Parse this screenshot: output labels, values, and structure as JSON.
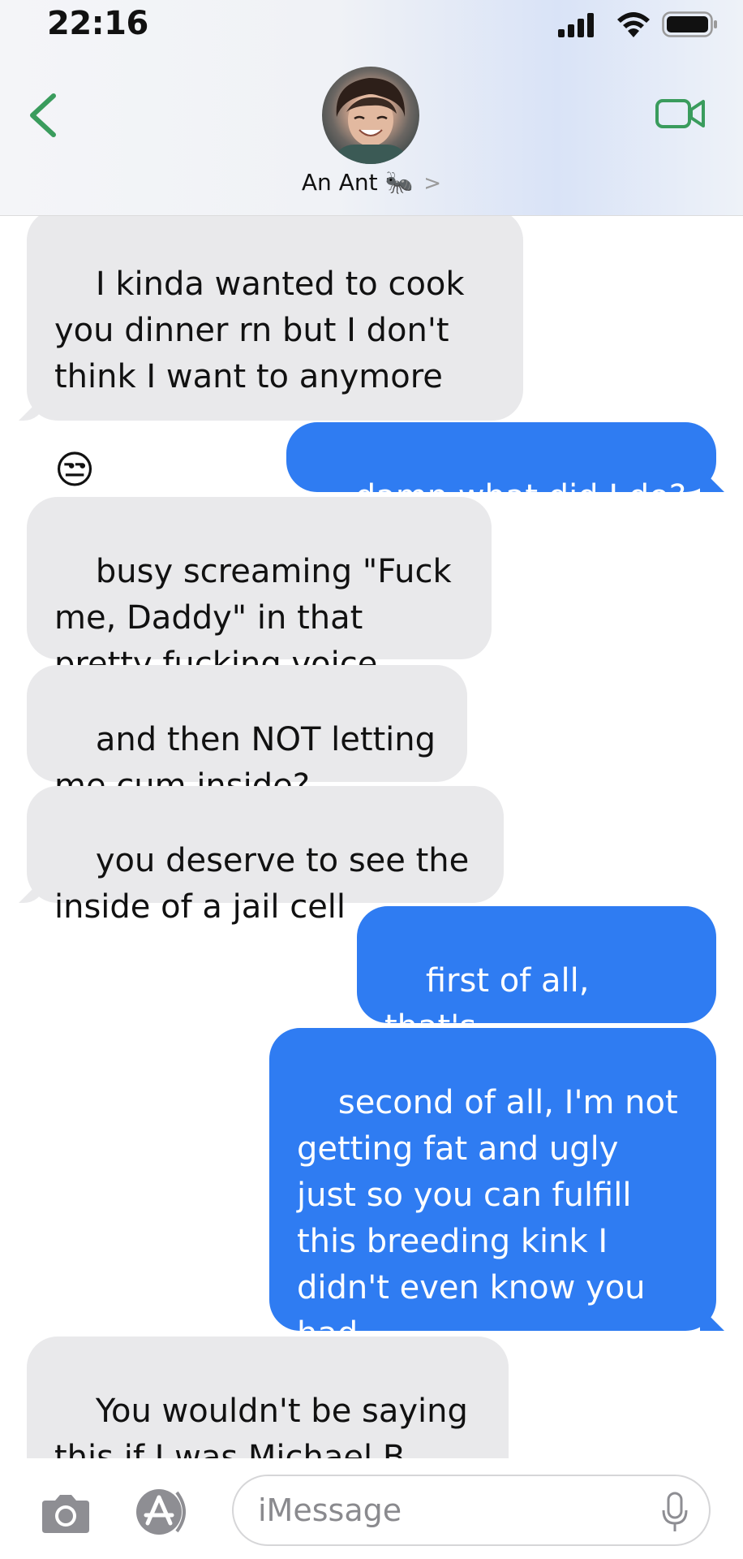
{
  "status_bar": {
    "time": "22:16"
  },
  "header": {
    "contact_name": "An Ant",
    "contact_emoji": "🐜",
    "chevron": ">",
    "icons": {
      "back": "chevron-left-icon",
      "video": "video-camera-icon"
    },
    "accent_color": "#3a9c5d"
  },
  "messages": [
    {
      "direction": "in",
      "text": "I kinda wanted to cook\nyou dinner rn but I don't\nthink I want to anymore",
      "emoji": "😒"
    },
    {
      "direction": "out",
      "text": "damn what did I do?"
    },
    {
      "direction": "in",
      "text": "busy screaming \"Fuck\nme, Daddy\" in that\npretty fucking voice"
    },
    {
      "direction": "in",
      "text": "and then NOT letting\nme cum inside?"
    },
    {
      "direction": "in",
      "text": "you deserve to see the\ninside of a jail cell"
    },
    {
      "direction": "out",
      "text": "first of all, that's\nroleplay?"
    },
    {
      "direction": "out",
      "text": "second of all, I'm not\ngetting fat and ugly\njust so you can fulfill\nthis breeding kink I\ndidn't even know you\nhad"
    },
    {
      "direction": "in",
      "text": "You wouldn't be saying\nthis if I was Michael B\nJordan probably"
    }
  ],
  "colors": {
    "incoming_bubble": "#e9e9eb",
    "outgoing_bubble": "#2f7cf2"
  },
  "composer": {
    "placeholder": "iMessage",
    "icons": {
      "camera": "camera-icon",
      "apps": "app-store-icon",
      "mic": "microphone-icon"
    }
  }
}
